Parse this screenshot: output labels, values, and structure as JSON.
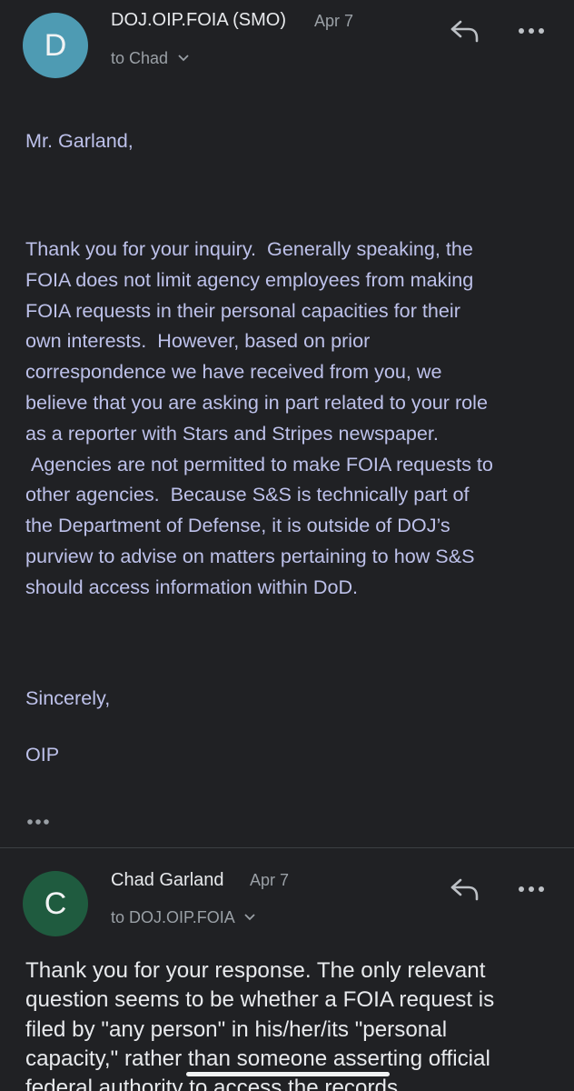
{
  "messages": [
    {
      "sender": "DOJ.OIP.FOIA (SMO)",
      "date": "Apr 7",
      "recipient": "to Chad",
      "avatar_letter": "D",
      "avatar_color": "#4e9bb3",
      "body_paragraphs": [
        "Mr. Garland,",
        "Thank you for your inquiry.  Generally speaking, the\nFOIA does not limit agency employees from making\nFOIA requests in their personal capacities for their\nown interests.  However, based on prior\ncorrespondence we have received from you, we\nbelieve that you are asking in part related to your role\nas a reporter with Stars and Stripes newspaper.\n Agencies are not permitted to make FOIA requests to\nother agencies.  Because S&S is technically part of\nthe Department of Defense, it is outside of DOJ’s\npurview to advise on matters pertaining to how S&S\nshould access information within DoD.",
        "Sincerely,",
        "OIP"
      ]
    },
    {
      "sender": "Chad Garland",
      "date": "Apr 7",
      "recipient": "to DOJ.OIP.FOIA",
      "avatar_letter": "C",
      "avatar_color": "#1f5b3f",
      "body": "Thank you for your response. The only relevant\nquestion seems to be whether a FOIA request is\nfiled by \"any person\" in his/her/its \"personal\ncapacity,\" rather than someone asserting official\nfederal authority to access the records."
    }
  ],
  "icons": {
    "reply": "reply-icon",
    "more": "more-options-icon",
    "expand": "chevron-down-icon",
    "trimmed": "show-trimmed-content-icon"
  },
  "colors": {
    "background": "#202124",
    "body_text": "#bdc1ea",
    "secondary_text": "#9aa0a6"
  }
}
